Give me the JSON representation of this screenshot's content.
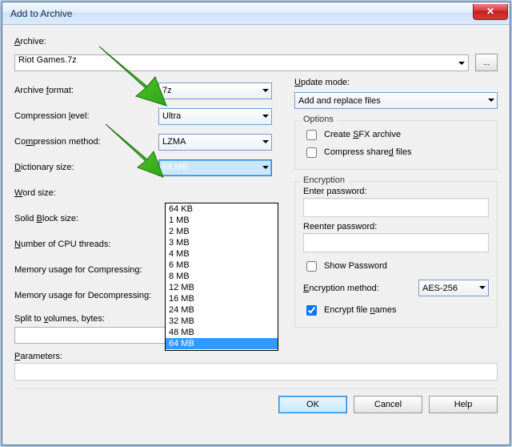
{
  "window": {
    "title": "Add to Archive"
  },
  "archive": {
    "label_prefix": "A",
    "label_rest": "rchive:",
    "value": "Riot Games.7z"
  },
  "left": {
    "format": {
      "label_prefix": "Archive ",
      "label_u": "f",
      "label_rest": "ormat:",
      "value": "7z"
    },
    "level": {
      "label": "Compression ",
      "label_u": "l",
      "label_rest": "evel:",
      "value": "Ultra"
    },
    "method": {
      "label": "Co",
      "label_u": "m",
      "label_rest": "pression method:",
      "value": "LZMA"
    },
    "dict": {
      "label_u": "D",
      "label_rest": "ictionary size:",
      "value": "64 MB"
    },
    "word": {
      "label_u": "W",
      "label_rest": "ord size:"
    },
    "solid": {
      "label": "Solid ",
      "label_u": "B",
      "label_rest": "lock size:"
    },
    "threads": {
      "label_u": "N",
      "label_rest": "umber of CPU threads:"
    },
    "memcomp": {
      "label": "Memory usage for Compressing:"
    },
    "memdecomp": {
      "label": "Memory usage for Decompressing:"
    },
    "split": {
      "label": "Split to ",
      "label_u": "v",
      "label_rest": "olumes, bytes:"
    }
  },
  "right": {
    "update": {
      "label_u": "U",
      "label_rest": "pdate mode:",
      "value": "Add and replace files"
    },
    "options_title": "Options",
    "sfx": {
      "label": "Create ",
      "label_u": "S",
      "label_rest": "FX archive",
      "checked": false
    },
    "shared": {
      "label": "Compress share",
      "label_u": "d",
      "label_rest": " files",
      "checked": false
    },
    "enc_title": "Encryption",
    "pw": {
      "label": "Enter password:"
    },
    "pw2": {
      "label": "Reenter password:"
    },
    "showpw": {
      "label": "Show Password",
      "checked": false
    },
    "encmeth": {
      "label_u": "E",
      "label_rest": "ncryption method:",
      "value": "AES-256"
    },
    "encnames": {
      "label": "Encrypt file ",
      "label_u": "n",
      "label_rest": "ames",
      "checked": true
    }
  },
  "params": {
    "label_u": "P",
    "label_rest": "arameters:"
  },
  "buttons": {
    "ok": "OK",
    "cancel": "Cancel",
    "help": "Help"
  },
  "dropdown_options": [
    "64 KB",
    "1 MB",
    "2 MB",
    "3 MB",
    "4 MB",
    "6 MB",
    "8 MB",
    "12 MB",
    "16 MB",
    "24 MB",
    "32 MB",
    "48 MB",
    "64 MB"
  ]
}
